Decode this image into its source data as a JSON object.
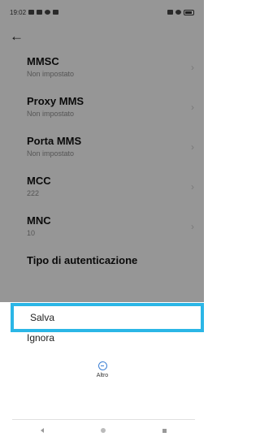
{
  "status_bar": {
    "time": "19:02",
    "icons_left": [
      "sim-icon",
      "data-icon",
      "message-icon",
      "notification-icon"
    ],
    "icons_right": [
      "signal-icon",
      "wifi-icon",
      "battery-icon"
    ]
  },
  "settings": {
    "rows": [
      {
        "title": "MMSC",
        "value": "Non impostato"
      },
      {
        "title": "Proxy MMS",
        "value": "Non impostato"
      },
      {
        "title": "Porta MMS",
        "value": "Non impostato"
      },
      {
        "title": "MCC",
        "value": "222"
      },
      {
        "title": "MNC",
        "value": "10"
      }
    ],
    "partial_row_title": "Tipo di autenticazione"
  },
  "sheet": {
    "save_label": "Salva",
    "discard_label": "Ignora",
    "more_label": "Altro"
  },
  "colors": {
    "highlight_border": "#2bb6e6",
    "accent": "#3b7fd4"
  }
}
